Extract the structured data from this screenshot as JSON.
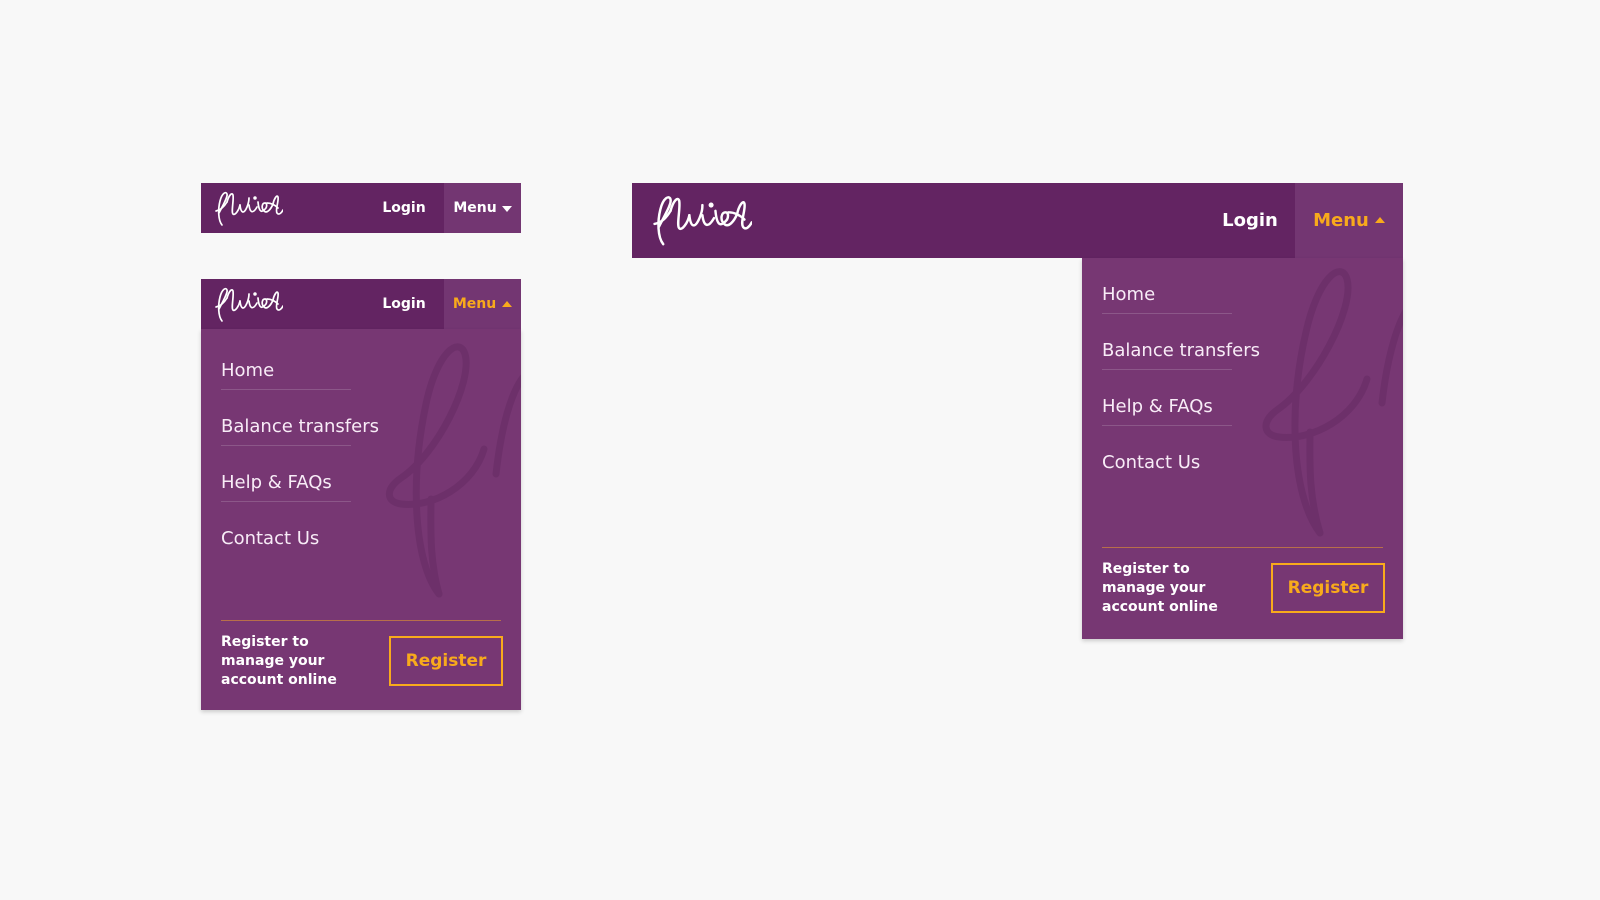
{
  "brand": {
    "name": "fluid",
    "logo_icon": "fluid-script-logo",
    "primary_color": "#632462",
    "panel_color": "#773773",
    "toggle_color": "#733672",
    "accent_color": "#f8aa1c",
    "text_color": "#ffffff"
  },
  "small_collapsed": {
    "login_label": "Login",
    "menu_label": "Menu",
    "menu_icon": "caret-down-icon"
  },
  "small_expanded": {
    "login_label": "Login",
    "menu_label": "Menu",
    "menu_icon": "caret-up-icon",
    "items": [
      {
        "label": "Home"
      },
      {
        "label": "Balance transfers"
      },
      {
        "label": "Help & FAQs"
      },
      {
        "label": "Contact Us"
      }
    ],
    "register_text": "Register to manage your account online",
    "register_label": "Register"
  },
  "large": {
    "login_label": "Login",
    "menu_label": "Menu",
    "menu_icon": "caret-up-icon",
    "items": [
      {
        "label": "Home"
      },
      {
        "label": "Balance transfers"
      },
      {
        "label": "Help & FAQs"
      },
      {
        "label": "Contact Us"
      }
    ],
    "register_text": "Register to manage your account online",
    "register_label": "Register"
  }
}
